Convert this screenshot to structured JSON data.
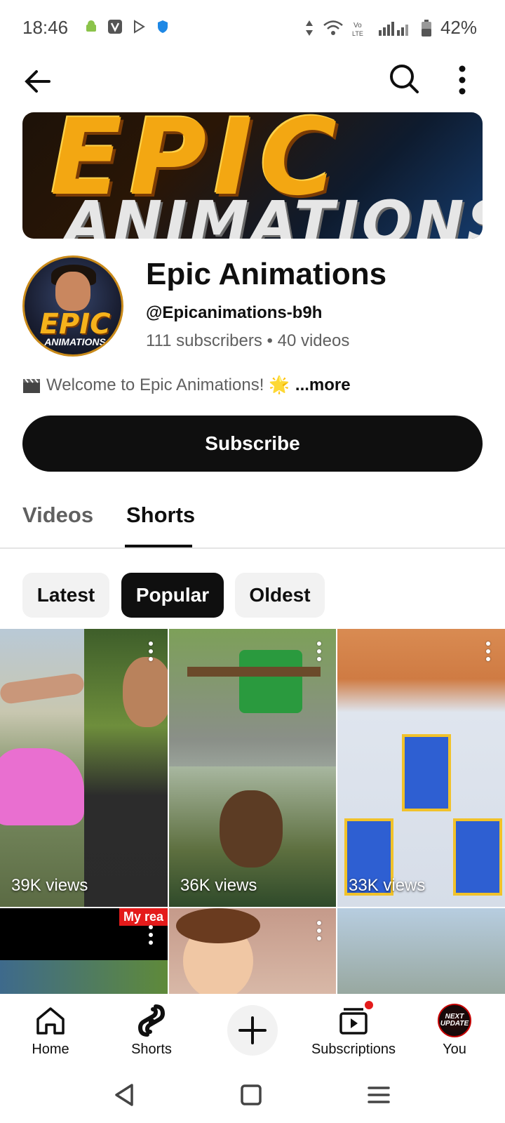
{
  "status_bar": {
    "time": "18:46",
    "battery": "42%"
  },
  "banner": {
    "title": "EPIC",
    "subtitle": "ANIMATIONS"
  },
  "channel": {
    "avatar_text": "EPIC",
    "avatar_subtext": "ANIMATIONS",
    "name": "Epic Animations",
    "handle": "@Epicanimations-b9h",
    "stats": "111 subscribers • 40 videos",
    "description": "Welcome to Epic Animations! 🌟",
    "description_more": "...more",
    "subscribe_label": "Subscribe"
  },
  "tabs": [
    {
      "label": "Videos",
      "selected": false
    },
    {
      "label": "Shorts",
      "selected": true
    }
  ],
  "chips": [
    {
      "label": "Latest",
      "selected": false
    },
    {
      "label": "Popular",
      "selected": true
    },
    {
      "label": "Oldest",
      "selected": false
    }
  ],
  "shorts": [
    {
      "views": "39K views"
    },
    {
      "views": "36K views"
    },
    {
      "views": "33K views"
    },
    {
      "views": "",
      "overlay_text": "My rea"
    },
    {
      "views": ""
    },
    {
      "views": ""
    }
  ],
  "bottom_nav": {
    "home": "Home",
    "shorts": "Shorts",
    "subscriptions": "Subscriptions",
    "you": "You",
    "you_avatar_text": "NEXT UPDATE"
  },
  "colors": {
    "primary_text": "#0f0f0f",
    "secondary_text": "#606060",
    "chip_bg": "#f2f2f2",
    "accent_red": "#e41b1b"
  }
}
